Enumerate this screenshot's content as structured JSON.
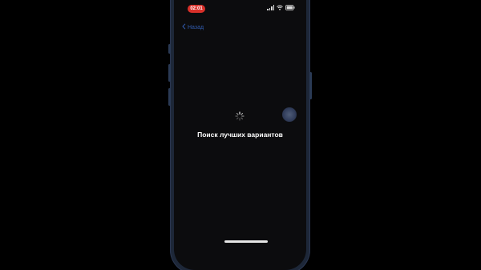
{
  "status_bar": {
    "time": "02:01"
  },
  "navigation": {
    "back_label": "Назад"
  },
  "content": {
    "loading_text": "Поиск лучших вариантов"
  },
  "colors": {
    "accent": "#3b6fd6",
    "recording_pill": "#d9302a",
    "frame": "#1d2738"
  },
  "icons": {
    "back": "chevron-left-icon",
    "spinner": "activity-spinner-icon",
    "wifi": "wifi-icon",
    "battery": "battery-icon",
    "signal": "cellular-signal-icon"
  }
}
